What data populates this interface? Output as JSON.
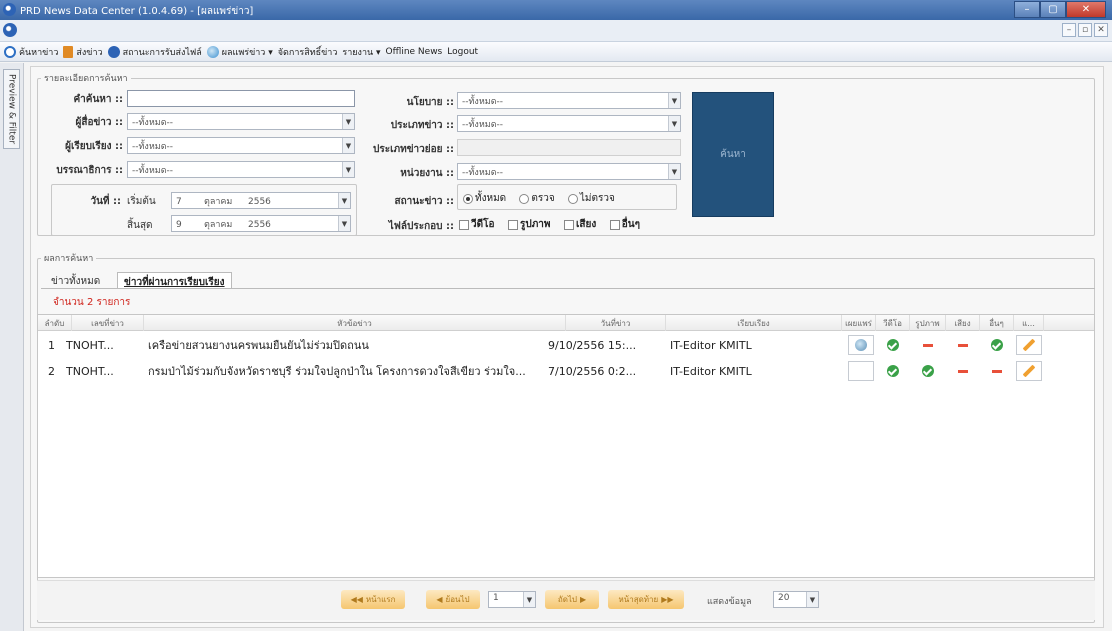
{
  "window": {
    "title": "PRD News Data Center (1.0.4.69) - [ผลแพร่ข่าว]",
    "minimize": "–",
    "maximize": "▢",
    "close": "✕"
  },
  "mdi": {
    "minimize": "–",
    "restore": "▫",
    "close": "✕"
  },
  "menu": {
    "items": [
      {
        "label": "ค้นหาข่าว",
        "icon": "search-icon",
        "color": "#2d6fc4"
      },
      {
        "label": "ส่งข่าว",
        "icon": "document-icon",
        "color": "#e08a25"
      },
      {
        "label": "สถานะการรับส่งไฟล์",
        "icon": "info-icon",
        "color": "#2d63b5"
      },
      {
        "label": "ผลแพร่ข่าว ▾",
        "icon": "globe-icon",
        "color": "#3a8fd0"
      },
      {
        "label": "จัดการสิทธิ์ข่าว",
        "icon": "",
        "color": ""
      },
      {
        "label": "รายงาน ▾",
        "icon": "",
        "color": ""
      },
      {
        "label": "Offline News",
        "icon": "",
        "color": ""
      },
      {
        "label": "Logout",
        "icon": "",
        "color": ""
      }
    ]
  },
  "side": {
    "tab_label": "Preview & Filter"
  },
  "criteria": {
    "legend": "รายละเอียดการค้นหา",
    "keyword_label": "คำค้นหา ::",
    "reporter_label": "ผู้สื่อข่าว ::",
    "writer_label": "ผู้เรียบเรียง ::",
    "editor_label": "บรรณาธิการ ::",
    "date_label": "วันที่ ::",
    "start_label": "เริ่มต้น",
    "end_label": "สิ้นสุด",
    "start_day": "7",
    "start_month": "ตุลาคม",
    "start_year": "2556",
    "end_day": "9",
    "end_month": "ตุลาคม",
    "end_year": "2556",
    "all_option": "--ทั้งหมด--",
    "policy_label": "นโยบาย ::",
    "news_type_label": "ประเภทข่าว ::",
    "news_subtype_label": "ประเภทข่าวย่อย ::",
    "agency_label": "หน่วยงาน ::",
    "status_label": "สถานะข่าว ::",
    "status_options": [
      "ทั้งหมด",
      "ตรวจ",
      "ไม่ตรวจ"
    ],
    "attach_label": "ไฟล์ประกอบ ::",
    "attach_options": [
      "วีดีโอ",
      "รูปภาพ",
      "เสียง",
      "อื่นๆ"
    ],
    "search_button": "ค้นหา"
  },
  "results": {
    "legend": "ผลการค้นหา",
    "tabs": [
      "ข่าวทั้งหมด",
      "ข่าวที่ผ่านการเรียบเรียง"
    ],
    "count_text": "จำนวน 2 รายการ",
    "headers": [
      "ลำดับ",
      "เลขที่ข่าว",
      "หัวข้อข่าว",
      "วันที่ข่าว",
      "เรียบเรียง",
      "เผยแพร่",
      "วีดีโอ",
      "รูปภาพ",
      "เสียง",
      "อื่นๆ",
      "แ..."
    ],
    "rows": [
      {
        "no": "1",
        "id": "TNOHT...",
        "headline": "เครือข่ายสวนยางนครพนมยืนยันไม่ร่วมปิดถนน",
        "date": "9/10/2556 15:...",
        "editor": "IT-Editor KMITL",
        "publish": "globe-icon",
        "video": "ok",
        "image": "none",
        "audio": "none",
        "other": "ok"
      },
      {
        "no": "2",
        "id": "TNOHT...",
        "headline": "กรมป่าไม้ร่วมกับจังหวัดราชบุรี ร่วมใจปลูกป่าใน โครงการดวงใจสีเขียว ร่วมใจ...",
        "date": "7/10/2556 0:2...",
        "editor": "IT-Editor KMITL",
        "publish": "",
        "video": "ok",
        "image": "ok",
        "audio": "none",
        "other": "none"
      }
    ]
  },
  "pager": {
    "first": "หน้าแรก",
    "prev": "ย้อนไป",
    "page_value": "1",
    "next": "ถัดไป",
    "last": "หน้าสุดท้าย",
    "show_label": "แสดงข้อมูล",
    "page_size": "20"
  }
}
